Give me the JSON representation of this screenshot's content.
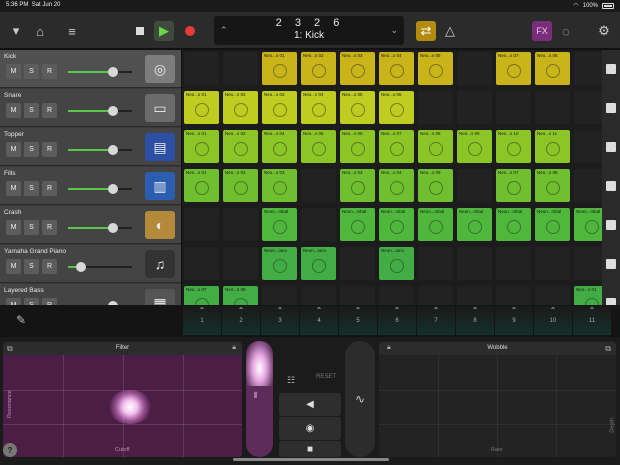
{
  "status": {
    "time": "5:36 PM",
    "date": "Sat Jun 20",
    "battery": "100%"
  },
  "toolbar": {
    "position": "2 3 2     6",
    "region": "1: Kick",
    "fx_label": "FX"
  },
  "tracks": [
    {
      "name": "Kick",
      "volume": 0.7,
      "instrument": "drum-kit-icon"
    },
    {
      "name": "Snare",
      "volume": 0.7,
      "instrument": "snare-drum-icon"
    },
    {
      "name": "Topper",
      "volume": 0.7,
      "instrument": "drum-machine-icon"
    },
    {
      "name": "Fills",
      "volume": 0.7,
      "instrument": "tom-drum-icon"
    },
    {
      "name": "Crash",
      "volume": 0.7,
      "instrument": "cymbal-icon"
    },
    {
      "name": "Yamaha Grand Piano",
      "volume": 0.2,
      "instrument": "grand-piano-icon"
    },
    {
      "name": "Layered Bass",
      "volume": 0.7,
      "instrument": "synth-icon"
    }
  ],
  "track_buttons": {
    "mute": "M",
    "solo": "S",
    "record": "R"
  },
  "cells": [
    {
      "row": 0,
      "col": 2,
      "label": "Neo...s 01",
      "color": "yel"
    },
    {
      "row": 0,
      "col": 3,
      "label": "Neo...s 02",
      "color": "yel"
    },
    {
      "row": 0,
      "col": 4,
      "label": "Neo...s 03",
      "color": "yel"
    },
    {
      "row": 0,
      "col": 5,
      "label": "Neo...s 04",
      "color": "yel"
    },
    {
      "row": 0,
      "col": 6,
      "label": "Neo...s 05",
      "color": "yel"
    },
    {
      "row": 0,
      "col": 8,
      "label": "Neo...s 07",
      "color": "yel"
    },
    {
      "row": 0,
      "col": 9,
      "label": "Neo...s 08",
      "color": "yel"
    },
    {
      "row": 1,
      "col": 0,
      "label": "Neo...s 01",
      "color": "lime"
    },
    {
      "row": 1,
      "col": 1,
      "label": "Neo...s 02",
      "color": "lime"
    },
    {
      "row": 1,
      "col": 2,
      "label": "Neo...s 03",
      "color": "lime"
    },
    {
      "row": 1,
      "col": 3,
      "label": "Neo...s 04",
      "color": "lime"
    },
    {
      "row": 1,
      "col": 4,
      "label": "Neo...s 05",
      "color": "lime"
    },
    {
      "row": 1,
      "col": 5,
      "label": "Neo...s 06",
      "color": "lime"
    },
    {
      "row": 2,
      "col": 0,
      "label": "Neo...s 01",
      "color": "grn1"
    },
    {
      "row": 2,
      "col": 1,
      "label": "Neo...s 02",
      "color": "grn1"
    },
    {
      "row": 2,
      "col": 2,
      "label": "Neo...s 04",
      "color": "grn1"
    },
    {
      "row": 2,
      "col": 3,
      "label": "Neo...s 05",
      "color": "grn1"
    },
    {
      "row": 2,
      "col": 4,
      "label": "Neo...s 06",
      "color": "grn1"
    },
    {
      "row": 2,
      "col": 5,
      "label": "Neo...s 07",
      "color": "grn1"
    },
    {
      "row": 2,
      "col": 6,
      "label": "Neo...s 08",
      "color": "grn1"
    },
    {
      "row": 2,
      "col": 7,
      "label": "Neo...s 09",
      "color": "grn1"
    },
    {
      "row": 2,
      "col": 8,
      "label": "Neo...s 10",
      "color": "grn1"
    },
    {
      "row": 2,
      "col": 9,
      "label": "Neo...s 11",
      "color": "grn1"
    },
    {
      "row": 3,
      "col": 0,
      "label": "Neo...s 01",
      "color": "grn2"
    },
    {
      "row": 3,
      "col": 1,
      "label": "Neo...s 02",
      "color": "grn2"
    },
    {
      "row": 3,
      "col": 2,
      "label": "Neo...s 03",
      "color": "grn2"
    },
    {
      "row": 3,
      "col": 4,
      "label": "Neo...s 03",
      "color": "grn2"
    },
    {
      "row": 3,
      "col": 5,
      "label": "Neo...s 04",
      "color": "grn2"
    },
    {
      "row": 3,
      "col": 6,
      "label": "Neo...s 05",
      "color": "grn2"
    },
    {
      "row": 3,
      "col": 8,
      "label": "Neo...s 07",
      "color": "grn2"
    },
    {
      "row": 3,
      "col": 9,
      "label": "Neo...s 08",
      "color": "grn2"
    },
    {
      "row": 4,
      "col": 2,
      "label": "Neon...mbal",
      "color": "grn3"
    },
    {
      "row": 4,
      "col": 4,
      "label": "Neon...mbal",
      "color": "grn3"
    },
    {
      "row": 4,
      "col": 5,
      "label": "Neon...mbal",
      "color": "grn3"
    },
    {
      "row": 4,
      "col": 6,
      "label": "Neon...mbal",
      "color": "grn3"
    },
    {
      "row": 4,
      "col": 7,
      "label": "Neon...mbal",
      "color": "grn3"
    },
    {
      "row": 4,
      "col": 8,
      "label": "Neon...mbal",
      "color": "grn3"
    },
    {
      "row": 4,
      "col": 9,
      "label": "Neon...mbal",
      "color": "grn3"
    },
    {
      "row": 4,
      "col": 10,
      "label": "Neon...mbal",
      "color": "grn3"
    },
    {
      "row": 5,
      "col": 2,
      "label": "Neon...iano",
      "color": "grn4"
    },
    {
      "row": 5,
      "col": 3,
      "label": "Neon...iano",
      "color": "grn4"
    },
    {
      "row": 5,
      "col": 5,
      "label": "Neon...iano",
      "color": "grn4"
    },
    {
      "row": 6,
      "col": 0,
      "label": "Neo...s 07",
      "color": "grn4"
    },
    {
      "row": 6,
      "col": 1,
      "label": "Neo...s 08",
      "color": "grn4"
    },
    {
      "row": 6,
      "col": 10,
      "label": "Neo...s 01",
      "color": "grn4"
    }
  ],
  "columns": [
    "1",
    "2",
    "3",
    "4",
    "5",
    "6",
    "7",
    "8",
    "9",
    "10",
    "11"
  ],
  "filter": {
    "title": "Filter",
    "x_label": "Cutoff",
    "y_label": "Resonance"
  },
  "wobble": {
    "title": "Wobble",
    "x_label": "Rate",
    "y_label": "Depth"
  },
  "controls": {
    "reset_label": "RESET"
  }
}
